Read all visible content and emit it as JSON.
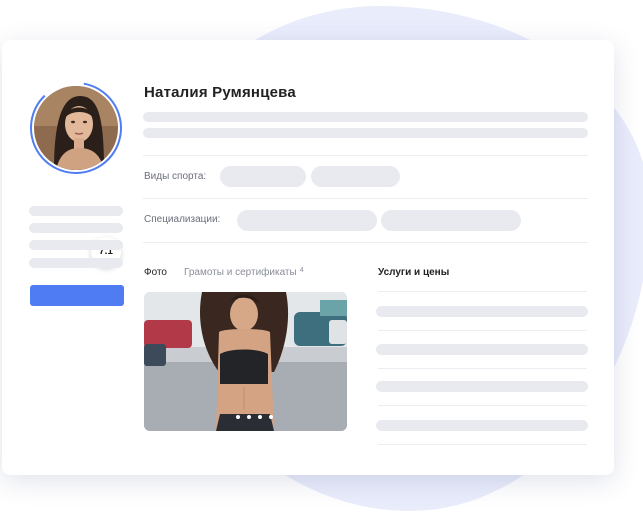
{
  "profile": {
    "name": "Наталия Румянцева",
    "rating": "7.1"
  },
  "fields": {
    "sports_label": "Виды спорта:",
    "specializations_label": "Специализации:"
  },
  "tabs": {
    "photo_label": "Фото",
    "certificates_label": "Грамоты и сертификаты",
    "certificates_count": "4"
  },
  "services": {
    "title": "Услуги и цены"
  },
  "colors": {
    "accent": "#4f7cf2",
    "skeleton": "#e8eaf0",
    "background_blob": "#e9ecfb"
  },
  "icons": {
    "avatar": "woman-portrait-photo",
    "gallery": "woman-fitness-photo"
  },
  "gallery": {
    "slide_count": 5,
    "active_slide": 1
  }
}
